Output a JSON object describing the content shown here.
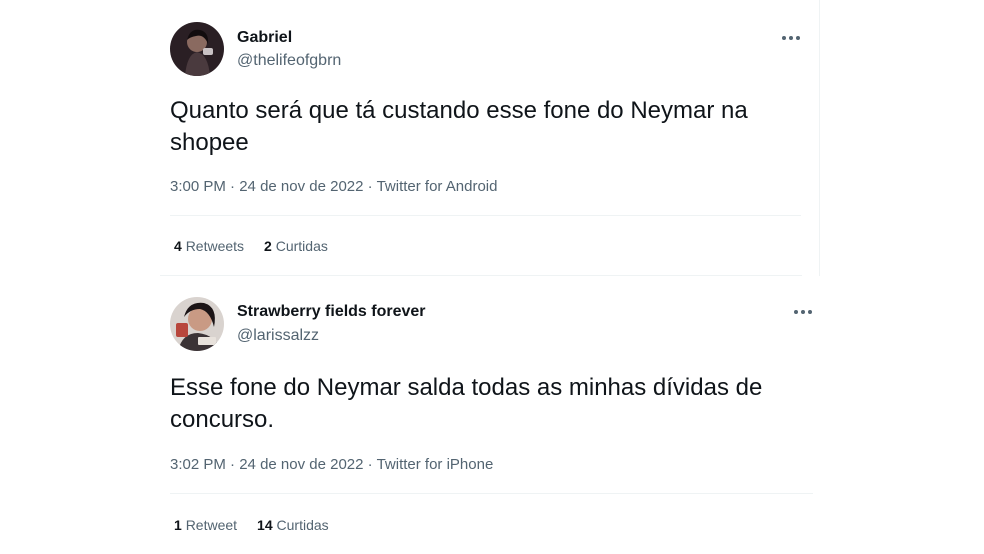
{
  "tweets": [
    {
      "name": "Gabriel",
      "handle": "@thelifeofgbrn",
      "text": "Quanto será que tá custando esse fone do Neymar na shopee",
      "time": "3:00 PM",
      "date": "24 de nov de 2022",
      "source": "Twitter for Android",
      "retweets_count": "4",
      "retweets_label": "Retweets",
      "likes_count": "2",
      "likes_label": "Curtidas"
    },
    {
      "name": "Strawberry fields forever",
      "handle": "@larissalzz",
      "text": "Esse fone do Neymar salda todas as minhas dívidas de concurso.",
      "time": "3:02 PM",
      "date": "24 de nov de 2022",
      "source": "Twitter for iPhone",
      "retweets_count": "1",
      "retweets_label": "Retweet",
      "likes_count": "14",
      "likes_label": "Curtidas"
    }
  ],
  "meta_separator": "·",
  "icons": {
    "more": "more-horizontal-icon"
  },
  "colors": {
    "text_primary": "#0f1419",
    "text_secondary": "#536471",
    "divider": "#eff3f4"
  }
}
